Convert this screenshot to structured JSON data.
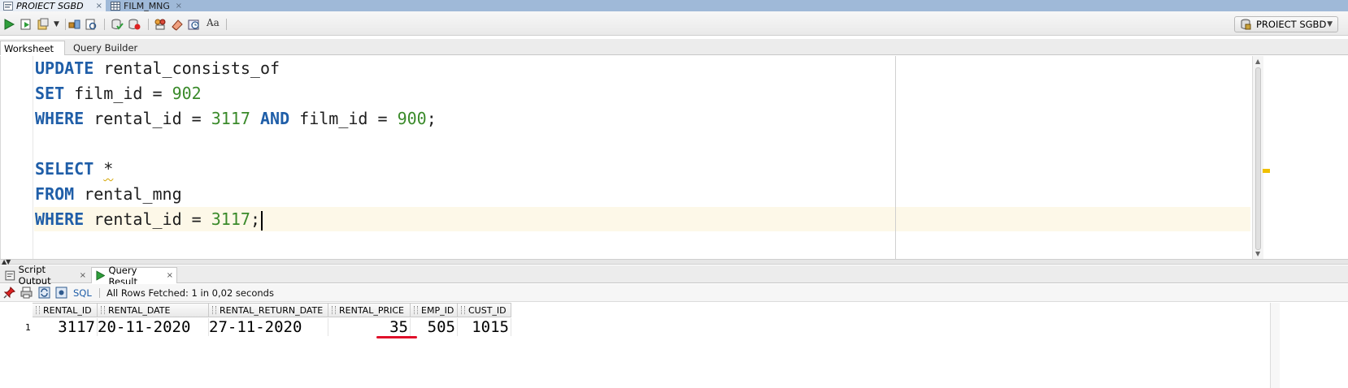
{
  "doc_tabs": [
    {
      "label": "PROIECT SGBD",
      "close": "×"
    },
    {
      "label": "FILM_MNG",
      "close": "×"
    }
  ],
  "connection": {
    "label": "PROIECT SGBD"
  },
  "worksheet_tabs": [
    "Worksheet",
    "Query Builder"
  ],
  "editor": {
    "lines": [
      [
        {
          "t": "UPDATE",
          "k": "kw"
        },
        {
          "t": " rental_consists_of",
          "k": ""
        }
      ],
      [
        {
          "t": "SET",
          "k": "kw"
        },
        {
          "t": " film_id = ",
          "k": ""
        },
        {
          "t": "902",
          "k": "num"
        }
      ],
      [
        {
          "t": "WHERE",
          "k": "kw"
        },
        {
          "t": " rental_id = ",
          "k": ""
        },
        {
          "t": "3117",
          "k": "num"
        },
        {
          "t": " ",
          "k": ""
        },
        {
          "t": "AND",
          "k": "kw"
        },
        {
          "t": " film_id = ",
          "k": ""
        },
        {
          "t": "900",
          "k": "num"
        },
        {
          "t": ";",
          "k": ""
        }
      ],
      [],
      [
        {
          "t": "SELECT",
          "k": "kw"
        },
        {
          "t": " ",
          "k": ""
        },
        {
          "t": "*",
          "k": "star"
        }
      ],
      [
        {
          "t": "FROM",
          "k": "kw"
        },
        {
          "t": " rental_mng",
          "k": ""
        }
      ],
      [
        {
          "t": "WHERE",
          "k": "kw"
        },
        {
          "t": " rental_id = ",
          "k": ""
        },
        {
          "t": "3117",
          "k": "num"
        },
        {
          "t": ";",
          "k": ""
        }
      ]
    ]
  },
  "result_tabs": [
    {
      "label": "Script Output",
      "close": "×"
    },
    {
      "label": "Query Result",
      "close": "×"
    }
  ],
  "result_toolbar": {
    "sql_label": "SQL",
    "status": "All Rows Fetched: 1 in 0,02 seconds"
  },
  "grid": {
    "columns": [
      "RENTAL_ID",
      "RENTAL_DATE",
      "RENTAL_RETURN_DATE",
      "RENTAL_PRICE",
      "EMP_ID",
      "CUST_ID"
    ],
    "rows": [
      {
        "num": "1",
        "cells": [
          "3117",
          "20-11-2020",
          "27-11-2020",
          "35",
          "505",
          "1015"
        ]
      }
    ]
  },
  "colors": {
    "keyword": "#1f5ea8",
    "number": "#3a8a2a",
    "highlight_underline": "#e0102a"
  }
}
